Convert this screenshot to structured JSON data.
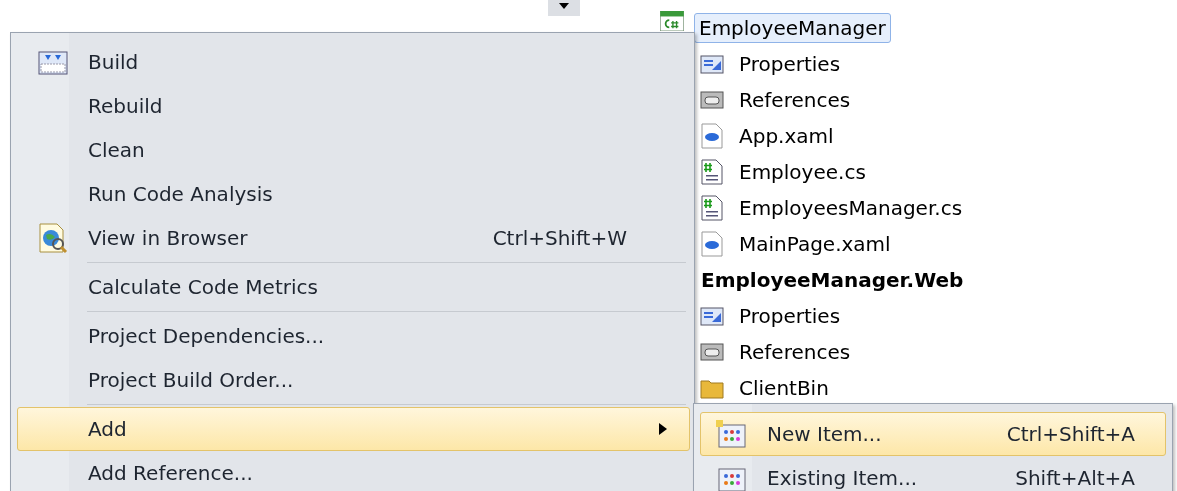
{
  "solution_explorer": {
    "items": [
      {
        "label": "EmployeeManager",
        "kind": "project",
        "bold": false,
        "selected": true,
        "children": [
          {
            "label": "Properties",
            "kind": "properties",
            "bold": false,
            "selected": false
          },
          {
            "label": "References",
            "kind": "references",
            "bold": false,
            "selected": false
          },
          {
            "label": "App.xaml",
            "kind": "xaml",
            "bold": false,
            "selected": false
          },
          {
            "label": "Employee.cs",
            "kind": "code",
            "bold": false,
            "selected": false
          },
          {
            "label": "EmployeesManager.cs",
            "kind": "code",
            "bold": false,
            "selected": false
          },
          {
            "label": "MainPage.xaml",
            "kind": "xaml",
            "bold": false,
            "selected": false
          }
        ]
      },
      {
        "label": "EmployeeManager.Web",
        "kind": "webproject",
        "bold": true,
        "selected": false,
        "children": [
          {
            "label": "Properties",
            "kind": "properties",
            "bold": false,
            "selected": false
          },
          {
            "label": "References",
            "kind": "references",
            "bold": false,
            "selected": false
          },
          {
            "label": "ClientBin",
            "kind": "folder",
            "bold": false,
            "selected": false
          }
        ]
      }
    ]
  },
  "context_menu": {
    "items": [
      {
        "kind": "build",
        "label": "Build",
        "selected": false,
        "submenu": false
      },
      {
        "kind": "plain",
        "label": "Rebuild",
        "selected": false,
        "submenu": false
      },
      {
        "kind": "plain",
        "label": "Clean",
        "selected": false,
        "submenu": false
      },
      {
        "kind": "plain",
        "label": "Run Code Analysis",
        "selected": false,
        "submenu": false
      },
      {
        "kind": "browser",
        "label": "View in Browser",
        "shortcut": "Ctrl+Shift+W",
        "selected": false,
        "submenu": false
      },
      {
        "kind": "separator"
      },
      {
        "kind": "plain",
        "label": "Calculate Code Metrics",
        "selected": false,
        "submenu": false
      },
      {
        "kind": "separator"
      },
      {
        "kind": "plain",
        "label": "Project Dependencies...",
        "selected": false,
        "submenu": false
      },
      {
        "kind": "plain",
        "label": "Project Build Order...",
        "selected": false,
        "submenu": false
      },
      {
        "kind": "separator"
      },
      {
        "kind": "plain",
        "label": "Add",
        "selected": true,
        "submenu": true
      },
      {
        "kind": "plain",
        "label": "Add Reference...",
        "selected": false,
        "submenu": false
      }
    ]
  },
  "submenu": {
    "items": [
      {
        "kind": "newitem",
        "label": "New Item...",
        "shortcut": "Ctrl+Shift+A",
        "selected": true,
        "submenu": false
      },
      {
        "kind": "existingitem",
        "label": "Existing Item...",
        "shortcut": "Shift+Alt+A",
        "selected": false,
        "submenu": false
      }
    ]
  }
}
